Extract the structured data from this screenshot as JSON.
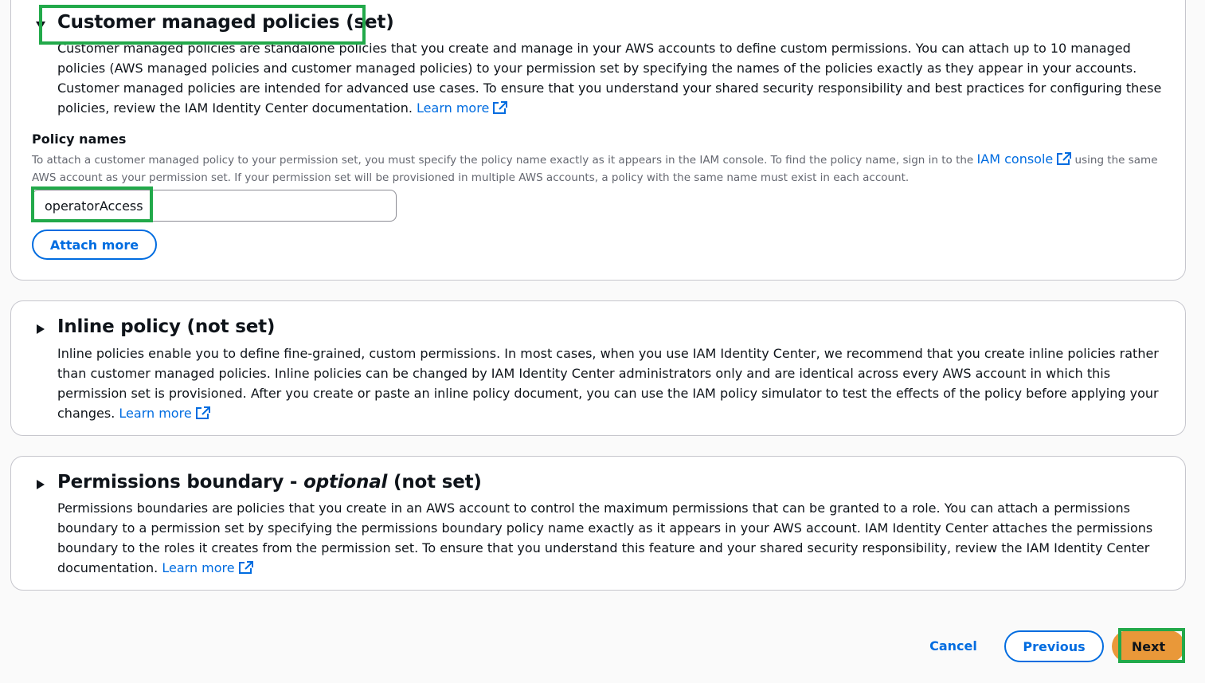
{
  "customer_policies": {
    "title": "Customer managed policies (set)",
    "description": "Customer managed policies are standalone policies that you create and manage in your AWS accounts to define custom permissions. You can attach up to 10 managed policies (AWS managed policies and customer managed policies) to your permission set by specifying the names of the policies exactly as they appear in your accounts. Customer managed policies are intended for advanced use cases. To ensure that you understand your shared security responsibility and best practices for configuring these policies, review the IAM Identity Center documentation.",
    "learn_more": "Learn more",
    "policy_names_label": "Policy names",
    "constraint_before": "To attach a customer managed policy to your permission set, you must specify the policy name exactly as it appears in the IAM console. To find the policy name, sign in to the",
    "iam_console_link": "IAM console",
    "constraint_after": "using the same AWS account as your permission set. If your permission set will be provisioned in multiple AWS accounts, a policy with the same name must exist in each account.",
    "policy_input_value": "operatorAccess",
    "attach_more": "Attach more"
  },
  "inline_policy": {
    "title": "Inline policy (not set)",
    "description": "Inline policies enable you to define fine-grained, custom permissions. In most cases, when you use IAM Identity Center, we recommend that you create inline policies rather than customer managed policies. Inline policies can be changed by IAM Identity Center administrators only and are identical across every AWS account in which this permission set is provisioned. After you create or paste an inline policy document, you can use the IAM policy simulator to test the effects of the policy before applying your changes.",
    "learn_more": "Learn more"
  },
  "permissions_boundary": {
    "title_prefix": "Permissions boundary - ",
    "title_optional": "optional",
    "title_suffix": " (not set)",
    "description": "Permissions boundaries are policies that you create in an AWS account to control the maximum permissions that can be granted to a role. You can attach a permissions boundary to a permission set by specifying the permissions boundary policy name exactly as it appears in your AWS account. IAM Identity Center attaches the permissions boundary to the roles it creates from the permission set. To ensure that you understand this feature and your shared security responsibility, review the IAM Identity Center documentation.",
    "learn_more": "Learn more"
  },
  "footer": {
    "cancel": "Cancel",
    "previous": "Previous",
    "next": "Next"
  },
  "colors": {
    "link": "#006ce0",
    "primary_button": "#e99839",
    "highlight": "#22a94a",
    "border": "#c6c6cd"
  },
  "icons": {
    "caret_expanded": "caret-down-icon",
    "caret_collapsed": "caret-right-icon",
    "external": "external-link-icon"
  }
}
